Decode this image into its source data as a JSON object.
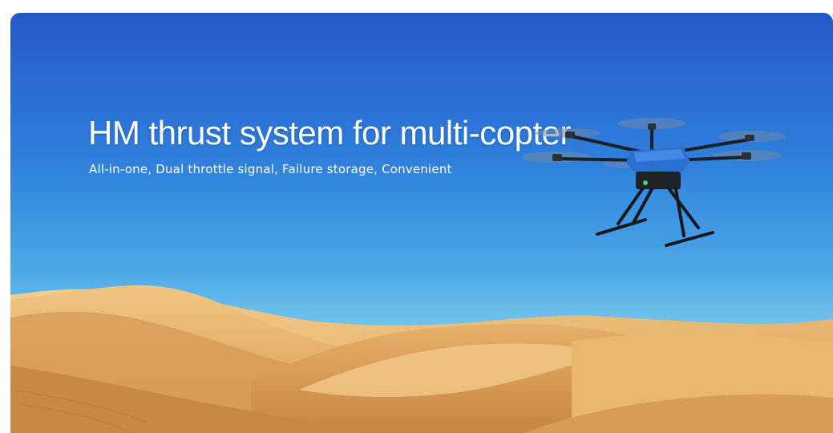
{
  "hero": {
    "title": "HM thrust system for multi-copter",
    "subtitle": "All-in-one, Dual throttle signal, Failure storage, Convenient",
    "image_subject": "hexacopter-drone-over-desert",
    "colors": {
      "sky_top": "#2558c9",
      "sky_bottom": "#a9dff2",
      "sand": "#e8b56c",
      "sand_shadow": "#c98a45",
      "drone_body": "#2a6fd1"
    }
  }
}
